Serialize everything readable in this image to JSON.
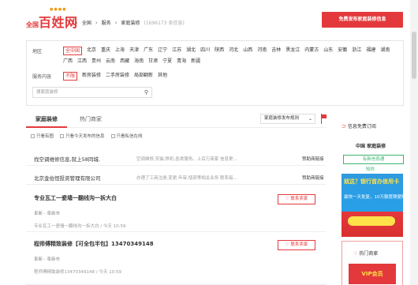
{
  "header": {
    "logo_prefix": "全国",
    "logo_main": "百姓网",
    "breadcrumb": [
      "全国",
      "服务",
      "家庭装修"
    ],
    "result_count": "(1696173 条信息)",
    "publish_button": "免费发布家庭装修信息"
  },
  "filters": {
    "region_label": "地区",
    "regions": [
      "全中国",
      "北京",
      "重庆",
      "上海",
      "天津",
      "广东",
      "辽宁",
      "江苏",
      "湖北",
      "四川",
      "陕西",
      "河北",
      "山西",
      "河南",
      "吉林",
      "黑龙江",
      "内蒙古",
      "山东",
      "安徽",
      "浙江",
      "福建",
      "湖南",
      "广西",
      "江西",
      "贵州",
      "云南",
      "西藏",
      "海南",
      "甘肃",
      "宁夏",
      "青海",
      "新疆"
    ],
    "selected_region": "全中国",
    "content_label": "服务内容",
    "contents": [
      "不限",
      "新房装修",
      "二手房装修",
      "局部翻新",
      "其他"
    ],
    "selected_content": "不限",
    "search_placeholder": "搜家庭装修"
  },
  "tabs": {
    "active": "家庭装修",
    "second": "热门商家",
    "sort_label": "家庭装修发布规则"
  },
  "checkboxes": [
    "只看有图",
    "只看今天发布的信息",
    "只看私信在线"
  ],
  "ads": [
    {
      "title": "找空调维修信息,就上58同城.",
      "desc": "空调维修,安装,移机,各类服务。上百万商家 信息更...",
      "tag": "赞助商链接"
    },
    {
      "title": "北京金伯恒投资管理有限公司",
      "desc": "办理了工商注册,变更,年审,增资等相关业务 联系每...",
      "tag": "赞助商链接"
    }
  ],
  "listings": [
    {
      "title": "专业瓦工一瓷墙一翻线沟一拆大白",
      "location": "阜新 - 阜新市",
      "meta": "专业瓦工一瓷墙一翻线沟一拆大白 / 今天 10:59",
      "contact": "联系卖家"
    },
    {
      "title": "程师傅精致装修【可全包半包】13470349148",
      "location": "阜新 - 阜新市",
      "meta": "程师傅精致装修13470349148 / 今天 10:59",
      "contact": "联系卖家"
    }
  ],
  "sidebar": {
    "subscribe_title": "信息免费订阅",
    "subscribe_sub": "中国 家庭装修",
    "new_info_button": "有新信息通",
    "link": "知你",
    "promo_line1": "就这？银行首办信用卡",
    "promo_line2": "最快一天批复，10万额度随便刷",
    "hot_title": "热门商家",
    "vip_label": "VIP会员"
  }
}
